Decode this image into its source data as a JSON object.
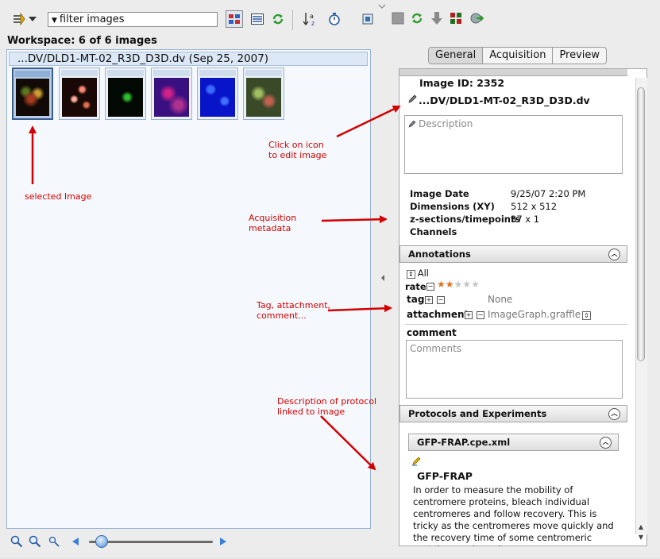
{
  "toolbar": {
    "filter_text": "filter  images",
    "icons": [
      "sort-arrows-icon",
      "dropdown-arrow-icon",
      "thumbnail-view-icon",
      "table-view-icon",
      "refresh-icon",
      "sort-az-icon",
      "timer-icon"
    ]
  },
  "workspace": {
    "label": "Workspace: 6 of 6 images",
    "dataset": "...DV/DLD1-MT-02_R3D_D3D.dv (Sep 25, 2007)",
    "thumbnails": [
      "cells-mixed",
      "cells-red",
      "cells-green",
      "cells-magenta",
      "cells-blue",
      "cells-green-red"
    ],
    "selected_index": 0
  },
  "zoom": {
    "slider_fraction": 0.1
  },
  "right_toolbar": {
    "icons": [
      "save-icon",
      "refresh-icon",
      "download-icon",
      "grid-icon",
      "export-icon"
    ]
  },
  "tabs": [
    "General",
    "Acquisition",
    "Preview"
  ],
  "active_tab": 0,
  "general": {
    "image_id_label": "Image  ID: 2352",
    "image_name": "...DV/DLD1-MT-02_R3D_D3D.dv",
    "description_placeholder": "Description",
    "metadata": [
      {
        "label": "Image Date",
        "value": "9/25/07 2:20 PM"
      },
      {
        "label": "Dimensions (XY)",
        "value": "512 x 512"
      },
      {
        "label": "z-sections/timepoints",
        "value": "37 x 1"
      },
      {
        "label": "Channels",
        "value": ""
      }
    ]
  },
  "annotations": {
    "title": "Annotations",
    "filter": "All",
    "rate_label": "rate",
    "rating": 2,
    "rating_max": 5,
    "tag_label": "tag",
    "tag_value": "None",
    "attachment_label": "attachment",
    "attachment_value": "ImageGraph.graffle",
    "comment_label": "comment",
    "comment_placeholder": "Comments"
  },
  "protocols": {
    "title": "Protocols and Experiments",
    "file": "GFP-FRAP.cpe.xml",
    "name": "GFP-FRAP",
    "description": "In order to measure the mobility of centromere proteins, bleach individual centromeres and follow recovery. This is tricky as the centromeres move quickly and the recovery time of some centromeric proteins can be quite"
  },
  "annotations_overlay": {
    "click_icon": "Click on icon\nto edit image",
    "selected_image": "selected Image",
    "acquisition_metadata": "Acquisition\nmetadata",
    "tag_attachment": "Tag, attachment,\ncomment...",
    "protocol_desc": "Description of protocol\nlinked to image"
  },
  "colors": {
    "accent_red": "#d20000",
    "selection": "#3a5f8f"
  }
}
